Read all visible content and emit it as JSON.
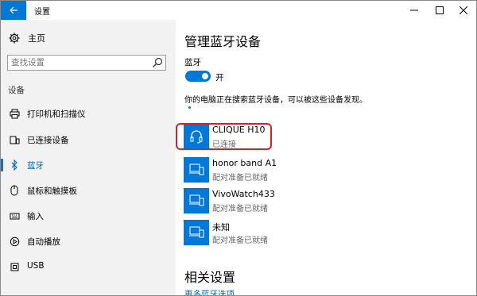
{
  "window": {
    "title": "设置",
    "back_icon": "back-arrow-icon",
    "minimize_icon": "minimize-icon",
    "maximize_icon": "maximize-icon",
    "close_icon": "close-icon"
  },
  "sidebar": {
    "home": {
      "label": "主页",
      "icon": "gear-icon"
    },
    "search": {
      "placeholder": "查找设置",
      "icon": "search-icon"
    },
    "section_label": "设备",
    "items": [
      {
        "label": "打印机和扫描仪",
        "icon": "printer-icon",
        "active": false
      },
      {
        "label": "已连接设备",
        "icon": "connected-devices-icon",
        "active": false
      },
      {
        "label": "蓝牙",
        "icon": "bluetooth-icon",
        "active": true
      },
      {
        "label": "鼠标和触摸板",
        "icon": "mouse-icon",
        "active": false
      },
      {
        "label": "输入",
        "icon": "keyboard-icon",
        "active": false
      },
      {
        "label": "自动播放",
        "icon": "autoplay-icon",
        "active": false
      },
      {
        "label": "USB",
        "icon": "usb-icon",
        "active": false
      }
    ]
  },
  "main": {
    "title": "管理蓝牙设备",
    "bluetooth_label": "蓝牙",
    "toggle": {
      "state": "开",
      "on": true
    },
    "discover_text": "你的电脑正在搜索蓝牙设备，可以被这些设备发现。",
    "devices": [
      {
        "name": "CLIQUE H10",
        "status": "已连接",
        "icon": "headset-icon",
        "highlighted": true
      },
      {
        "name": "honor band A1",
        "status": "配对准备已就绪",
        "icon": "phone-device-icon",
        "highlighted": false
      },
      {
        "name": "VivoWatch433",
        "status": "配对准备已就绪",
        "icon": "phone-device-icon",
        "highlighted": false
      },
      {
        "name": "未知",
        "status": "配对准备已就绪",
        "icon": "phone-device-icon",
        "highlighted": false
      }
    ],
    "related_title": "相关设置",
    "related_link": "更多蓝牙选项"
  },
  "colors": {
    "accent": "#0078d7",
    "highlight_border": "#c8262e",
    "sidebar_bg": "#f2f2f2"
  }
}
